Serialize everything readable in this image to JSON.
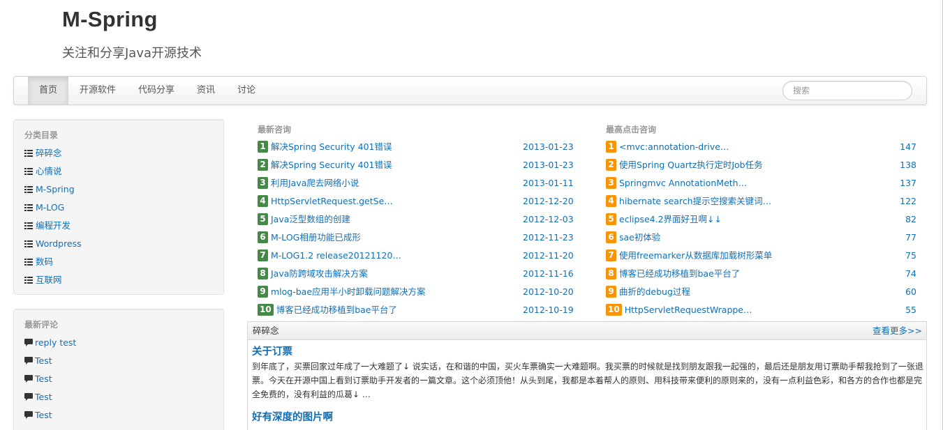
{
  "site": {
    "title": "M-Spring",
    "subtitle": "关注和分享Java开源技术"
  },
  "nav": {
    "items": [
      {
        "label": "首页"
      },
      {
        "label": "开源软件"
      },
      {
        "label": "代码分享"
      },
      {
        "label": "资讯"
      },
      {
        "label": "讨论"
      }
    ],
    "active_index": 0,
    "search_placeholder": "搜索"
  },
  "sidebar": {
    "categories": {
      "header": "分类目录",
      "icon": "list-icon",
      "items": [
        {
          "label": "碎碎念"
        },
        {
          "label": "心情说"
        },
        {
          "label": "M-Spring"
        },
        {
          "label": "M-LOG"
        },
        {
          "label": "编程开发"
        },
        {
          "label": "Wordpress"
        },
        {
          "label": "数码"
        },
        {
          "label": "互联网"
        }
      ]
    },
    "comments": {
      "header": "最新评论",
      "icon": "comment-icon",
      "items": [
        {
          "label": "reply test"
        },
        {
          "label": "Test"
        },
        {
          "label": "Test"
        },
        {
          "label": "Test"
        },
        {
          "label": "Test"
        }
      ]
    }
  },
  "latest": {
    "header": "最新咨询",
    "badge_color": "#468847",
    "items": [
      {
        "rank": "1",
        "title": "解决Spring Security 401错误",
        "date": "2013-01-23"
      },
      {
        "rank": "2",
        "title": "解决Spring Security 401错误",
        "date": "2013-01-23"
      },
      {
        "rank": "3",
        "title": "利用Java爬去网络小说",
        "date": "2013-01-11"
      },
      {
        "rank": "4",
        "title": "HttpServletRequest.getSe…",
        "date": "2012-12-20"
      },
      {
        "rank": "5",
        "title": "Java泛型数组的创建",
        "date": "2012-12-03"
      },
      {
        "rank": "6",
        "title": "M-LOG相册功能已成形",
        "date": "2012-11-23"
      },
      {
        "rank": "7",
        "title": "M-LOG1.2 release20121120…",
        "date": "2012-11-20"
      },
      {
        "rank": "8",
        "title": "Java防跨域攻击解决方案",
        "date": "2012-11-16"
      },
      {
        "rank": "9",
        "title": "mlog-bae应用半小时卸载问题解决方案",
        "date": "2012-10-20"
      },
      {
        "rank": "10",
        "title": "博客已经成功移植到bae平台了",
        "date": "2012-10-19"
      }
    ]
  },
  "popular": {
    "header": "最高点击咨询",
    "badge_color": "#f89406",
    "items": [
      {
        "rank": "1",
        "title": "<mvc:annotation-drive…",
        "count": "147"
      },
      {
        "rank": "2",
        "title": "使用Spring Quartz执行定时Job任务",
        "count": "138"
      },
      {
        "rank": "3",
        "title": "Springmvc AnnotationMeth…",
        "count": "137"
      },
      {
        "rank": "4",
        "title": "hibernate search提示空搜索关键词…",
        "count": "122"
      },
      {
        "rank": "5",
        "title": "eclipse4.2界面好丑啊↓↓",
        "count": "82"
      },
      {
        "rank": "6",
        "title": "sae初体验",
        "count": "77"
      },
      {
        "rank": "7",
        "title": "使用freemarker从数据库加载树形菜单",
        "count": "75"
      },
      {
        "rank": "8",
        "title": "博客已经成功移植到bae平台了",
        "count": "74"
      },
      {
        "rank": "9",
        "title": "曲折的debug过程",
        "count": "60"
      },
      {
        "rank": "10",
        "title": "HttpServletRequestWrappe…",
        "count": "55"
      }
    ]
  },
  "section": {
    "title": "碎碎念",
    "more": "查看更多>>",
    "posts": [
      {
        "title": "关于订票",
        "excerpt": "到年底了，买票回家过年成了一大难题了↓ 说实话，在和谐的中国，买火车票确实一大难题啊。我买票的时候就是找到朋友跟我一起强的，最后还是朋友用订票助手帮我抢到了一张退票。今天在开源中国上看到订票助手开发者的一篇文章。这个必须顶他！从头到尾，我都是本着帮人的原则、用科技带来便利的原则来的，没有一点利益色彩，和各方的合作也都是完全免费的，没有利益的瓜葛↓ …"
      },
      {
        "title": "好有深度的图片啊",
        "excerpt": ""
      }
    ]
  }
}
